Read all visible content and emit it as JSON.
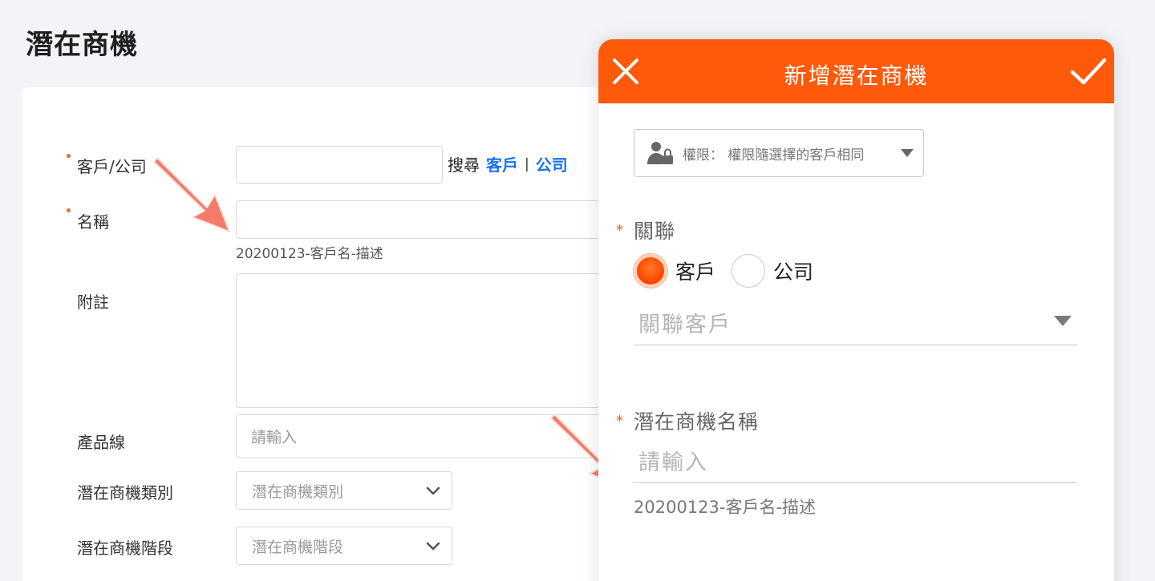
{
  "page": {
    "title": "潛在商機"
  },
  "form": {
    "customer_company_label": "客戶/公司",
    "search_label": "搜尋",
    "search_customer_link": "客戶",
    "search_separator": "|",
    "search_company_link": "公司",
    "name_label": "名稱",
    "name_hint": "20200123-客戶名-描述",
    "note_label": "附註",
    "product_line_label": "產品線",
    "product_line_placeholder": "請輸入",
    "opportunity_type_label": "潛在商機類別",
    "opportunity_type_value": "潛在商機類別",
    "opportunity_stage_label": "潛在商機階段",
    "opportunity_stage_value": "潛在商機階段"
  },
  "modal": {
    "title": "新增潛在商機",
    "permission_text": "權限： 權限隨選擇的客戶相同",
    "relation_label": "關聯",
    "radio_customer": "客戶",
    "radio_company": "公司",
    "relation_selected": "客戶",
    "relation_customer_placeholder": "關聯客戶",
    "opportunity_name_label": "潛在商機名稱",
    "opportunity_name_placeholder": "請輸入",
    "opportunity_name_hint": "20200123-客戶名-描述",
    "required_mark": "*"
  },
  "colors": {
    "accent": "#ff5a0a",
    "link": "#1a73e8",
    "required_dot": "#f06c2a",
    "arrow": "#f47a6a"
  },
  "icons": {
    "close": "close-icon",
    "confirm": "check-icon",
    "permission": "user-lock-icon",
    "chevron": "chevron-down-icon"
  }
}
